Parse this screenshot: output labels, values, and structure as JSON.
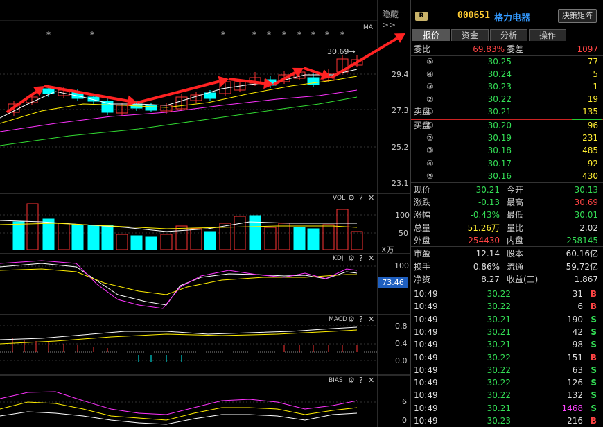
{
  "chart": {
    "hide_label": "隐藏",
    "ma_label": "MA",
    "high_marker": "30.69",
    "price_ticks": [
      "29.4",
      "27.3",
      "25.2",
      "23.1"
    ],
    "vol_label": "VOL",
    "vol_ticks": [
      "100",
      "50"
    ],
    "vol_unit": "X万",
    "kdj_label": "KDJ",
    "kdj_ticks": [
      "100"
    ],
    "kdj_value": "73.46",
    "macd_label": "MACD",
    "macd_ticks": [
      "0.8",
      "0.4",
      "0.0"
    ],
    "bias_label": "BIAS",
    "bias_ticks": [
      "6",
      "0"
    ],
    "gear_icon": "gear-icon",
    "help_icon": "question-icon",
    "close_icon": "close-icon"
  },
  "header": {
    "badge": "R",
    "code": "000651",
    "name": "格力电器",
    "decision_button": "决策矩阵"
  },
  "tabs": [
    "报价",
    "资金",
    "分析",
    "操作"
  ],
  "quote": {
    "weibi_label": "委比",
    "weibi_value": "69.83%",
    "weicha_label": "委差",
    "weicha_value": "1097",
    "sell": [
      {
        "label": "",
        "num": "⑤",
        "price": "30.25",
        "vol": "77"
      },
      {
        "label": "",
        "num": "④",
        "price": "30.24",
        "vol": "5"
      },
      {
        "label": "",
        "num": "③",
        "price": "30.23",
        "vol": "1"
      },
      {
        "label": "",
        "num": "②",
        "price": "30.22",
        "vol": "19"
      },
      {
        "label": "卖盘",
        "num": "①",
        "price": "30.21",
        "vol": "135"
      }
    ],
    "buy": [
      {
        "label": "买盘",
        "num": "①",
        "price": "30.20",
        "vol": "96"
      },
      {
        "label": "",
        "num": "②",
        "price": "30.19",
        "vol": "231"
      },
      {
        "label": "",
        "num": "③",
        "price": "30.18",
        "vol": "485"
      },
      {
        "label": "",
        "num": "④",
        "price": "30.17",
        "vol": "92"
      },
      {
        "label": "",
        "num": "⑤",
        "price": "30.16",
        "vol": "430"
      }
    ],
    "stats": [
      {
        "l1": "现价",
        "v1": "30.21",
        "c1": "g",
        "l2": "今开",
        "v2": "30.13",
        "c2": "g"
      },
      {
        "l1": "涨跌",
        "v1": "-0.13",
        "c1": "g",
        "l2": "最高",
        "v2": "30.69",
        "c2": "r"
      },
      {
        "l1": "涨幅",
        "v1": "-0.43%",
        "c1": "g",
        "l2": "最低",
        "v2": "30.01",
        "c2": "g"
      },
      {
        "l1": "总量",
        "v1": "51.26万",
        "c1": "y",
        "l2": "量比",
        "v2": "2.02",
        "c2": "w"
      },
      {
        "l1": "外盘",
        "v1": "254430",
        "c1": "r",
        "l2": "内盘",
        "v2": "258145",
        "c2": "g"
      }
    ],
    "fin": [
      {
        "l1": "市盈",
        "v1": "12.14",
        "l2": "股本",
        "v2": "60.16亿"
      },
      {
        "l1": "换手",
        "v1": "0.86%",
        "l2": "流通",
        "v2": "59.72亿"
      },
      {
        "l1": "净资",
        "v1": "8.27",
        "l2": "收益(三)",
        "v2": "1.867"
      }
    ]
  },
  "ticks": [
    {
      "time": "10:49",
      "price": "30.22",
      "vol": "31",
      "dir": "B",
      "vc": "w"
    },
    {
      "time": "10:49",
      "price": "30.22",
      "vol": "6",
      "dir": "B",
      "vc": "w"
    },
    {
      "time": "10:49",
      "price": "30.21",
      "vol": "190",
      "dir": "S",
      "vc": "w"
    },
    {
      "time": "10:49",
      "price": "30.21",
      "vol": "42",
      "dir": "S",
      "vc": "w"
    },
    {
      "time": "10:49",
      "price": "30.21",
      "vol": "98",
      "dir": "S",
      "vc": "w"
    },
    {
      "time": "10:49",
      "price": "30.22",
      "vol": "151",
      "dir": "B",
      "vc": "w"
    },
    {
      "time": "10:49",
      "price": "30.22",
      "vol": "63",
      "dir": "S",
      "vc": "w"
    },
    {
      "time": "10:49",
      "price": "30.22",
      "vol": "126",
      "dir": "S",
      "vc": "w"
    },
    {
      "time": "10:49",
      "price": "30.22",
      "vol": "132",
      "dir": "S",
      "vc": "w"
    },
    {
      "time": "10:49",
      "price": "30.21",
      "vol": "1468",
      "dir": "S",
      "vc": "m"
    },
    {
      "time": "10:49",
      "price": "30.23",
      "vol": "216",
      "dir": "B",
      "vc": "w"
    }
  ],
  "colors": {
    "up": "#ff3333",
    "down": "#00ffff",
    "accent": "#3399ff",
    "arrow": "#ff2222"
  }
}
